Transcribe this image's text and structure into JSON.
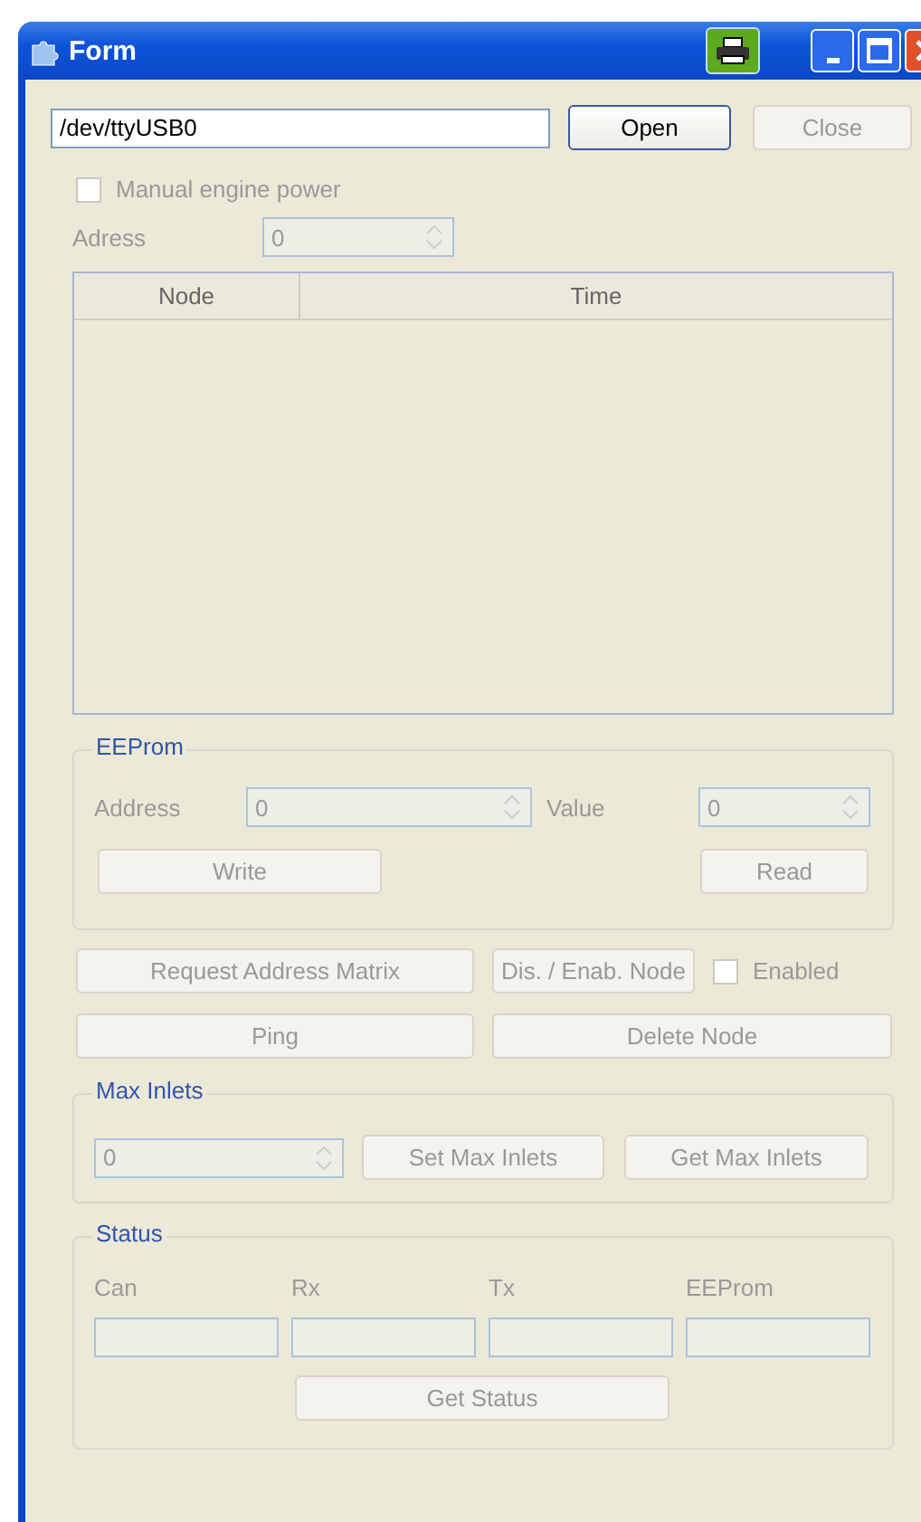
{
  "window": {
    "title": "Form"
  },
  "port_field": {
    "value": "/dev/ttyUSB0",
    "disabled": false
  },
  "open_button": {
    "label": "Open",
    "disabled": false
  },
  "close_button": {
    "label": "Close",
    "disabled": true
  },
  "manual_engine_power": {
    "label": "Manual engine power",
    "checked": false,
    "disabled": true
  },
  "adress": {
    "label": "Adress",
    "value": "0",
    "disabled": true
  },
  "table": {
    "columns": [
      "Node",
      "Time"
    ]
  },
  "eeprom": {
    "title": "EEProm",
    "address_label": "Address",
    "address_value": "0",
    "value_label": "Value",
    "value_value": "0",
    "write_button": {
      "label": "Write",
      "disabled": true
    },
    "read_button": {
      "label": "Read",
      "disabled": true
    }
  },
  "request_address_matrix_button": {
    "label": "Request Address Matrix",
    "disabled": true
  },
  "dis_enab_node_button": {
    "label": "Dis. / Enab. Node",
    "disabled": true
  },
  "enabled_checkbox": {
    "label": "Enabled",
    "checked": false,
    "disabled": true
  },
  "ping_button": {
    "label": "Ping",
    "disabled": true
  },
  "delete_node_button": {
    "label": "Delete Node",
    "disabled": true
  },
  "max_inlets": {
    "title": "Max Inlets",
    "value": "0",
    "set_button": {
      "label": "Set Max Inlets",
      "disabled": true
    },
    "get_button": {
      "label": "Get Max Inlets",
      "disabled": true
    }
  },
  "status": {
    "title": "Status",
    "fields": [
      {
        "label": "Can"
      },
      {
        "label": "Rx"
      },
      {
        "label": "Tx"
      },
      {
        "label": "EEProm"
      }
    ],
    "get_button": {
      "label": "Get Status",
      "disabled": true
    }
  }
}
